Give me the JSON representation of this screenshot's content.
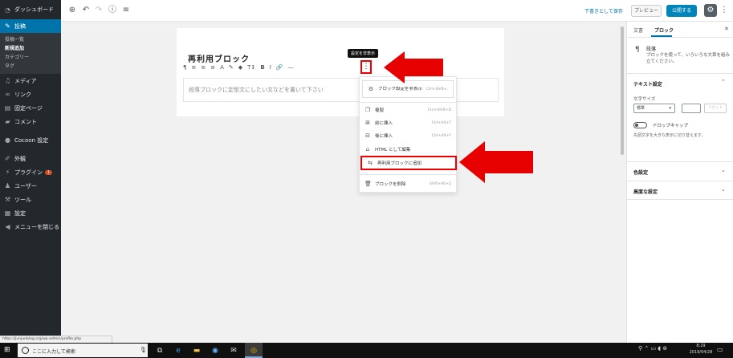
{
  "sidebar": {
    "dashboard": "ダッシュボード",
    "posts": "投稿",
    "posts_sub": [
      "投稿一覧",
      "新規追加",
      "カテゴリー",
      "タグ"
    ],
    "media": "メディア",
    "links": "リンク",
    "pages": "固定ページ",
    "comments": "コメント",
    "cocoon": "Cocoon 設定",
    "appearance": "外観",
    "plugins": "プラグイン",
    "plugins_badge": "1",
    "users": "ユーザー",
    "tools": "ツール",
    "settings": "設定",
    "collapse": "メニューを閉じる"
  },
  "header": {
    "save_draft": "下書きとして保存",
    "preview": "プレビュー",
    "publish": "公開する"
  },
  "editor": {
    "title": "再利用ブロック",
    "placeholder": "段落ブロックに定型文にしたい文などを書いて下さい",
    "tooltip": "設定を非表示",
    "toolbar": [
      "¶",
      "≡",
      "≡",
      "≡",
      "A",
      "✎",
      "◆",
      "T↕",
      "B",
      "I",
      "🔗",
      "—"
    ]
  },
  "block_menu": {
    "items": [
      {
        "label": "ブロック設定を非表示",
        "key": "Ctrl+Shift+,"
      },
      {
        "label": "複製",
        "key": "Ctrl+Shift+D"
      },
      {
        "label": "前に挿入",
        "key": "Ctrl+Alt+T"
      },
      {
        "label": "後に挿入",
        "key": "Ctrl+Alt+Y"
      },
      {
        "label": "HTML として編集",
        "key": ""
      },
      {
        "label": "再利用ブロックに追加",
        "key": ""
      },
      {
        "label": "ブロックを削除",
        "key": "Shift+Alt+Z"
      }
    ]
  },
  "right_panel": {
    "tab_document": "文書",
    "tab_block": "ブロック",
    "block_name": "段落",
    "block_desc": "ブロックを使って、いろいろな文章を組み立てください。",
    "text_settings": "テキスト設定",
    "font_size_label": "文字サイズ",
    "font_size_value": "標準",
    "reset": "リセット",
    "dropcap_label": "ドロップキャップ",
    "dropcap_help": "先頭文字を大きな表示に切り替えます。",
    "color_settings": "色設定",
    "advanced": "高度な設定"
  },
  "statusbar": {
    "url": "https://junjunblog.org/wp-admin/profile.php"
  },
  "taskbar": {
    "search_text": "ここに入力して検索",
    "time": "8:29",
    "date": "2019/04/28"
  }
}
